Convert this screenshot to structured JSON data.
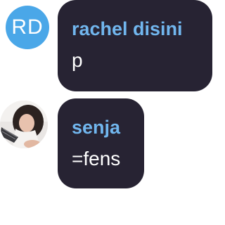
{
  "messages": [
    {
      "sender": "rachel disini",
      "text": "p",
      "avatar": {
        "type": "initials",
        "initials": "RD",
        "color": "#4aa7e8"
      }
    },
    {
      "sender": "senja",
      "text": "=fens",
      "avatar": {
        "type": "photo"
      }
    }
  ],
  "colors": {
    "bubble": "#272333",
    "sender_name": "#71b6ee",
    "message_text": "#ffffff"
  }
}
